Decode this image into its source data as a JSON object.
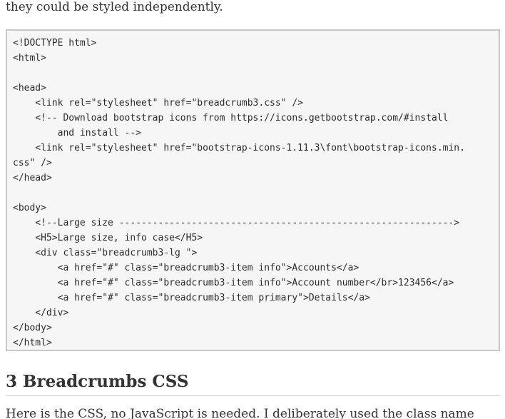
{
  "intro_fragment": "they could be styled independently.",
  "code_lines": [
    "<!DOCTYPE html>",
    "<html>",
    "",
    "<head>",
    "    <link rel=\"stylesheet\" href=\"breadcrumb3.css\" />",
    "    <!-- Download bootstrap icons from https://icons.getbootstrap.com/#install",
    "        and install -->",
    "    <link rel=\"stylesheet\" href=\"bootstrap-icons-1.11.3\\font\\bootstrap-icons.min.",
    "css\" />",
    "</head>",
    "",
    "<body>",
    "    <!--Large size ------------------------------------------------------------>",
    "    <H5>Large size, info case</H5>",
    "    <div class=\"breadcrumb3-lg \">",
    "        <a href=\"#\" class=\"breadcrumb3-item info\">Accounts</a>",
    "        <a href=\"#\" class=\"breadcrumb3-item info\">Account number</br>123456</a>",
    "        <a href=\"#\" class=\"breadcrumb3-item primary\">Details</a>",
    "    </div>",
    "</body>",
    "</html>"
  ],
  "section_heading": "3 Breadcrumbs CSS",
  "section_intro": "Here is the CSS, no JavaScript is needed. I deliberately used the class name"
}
